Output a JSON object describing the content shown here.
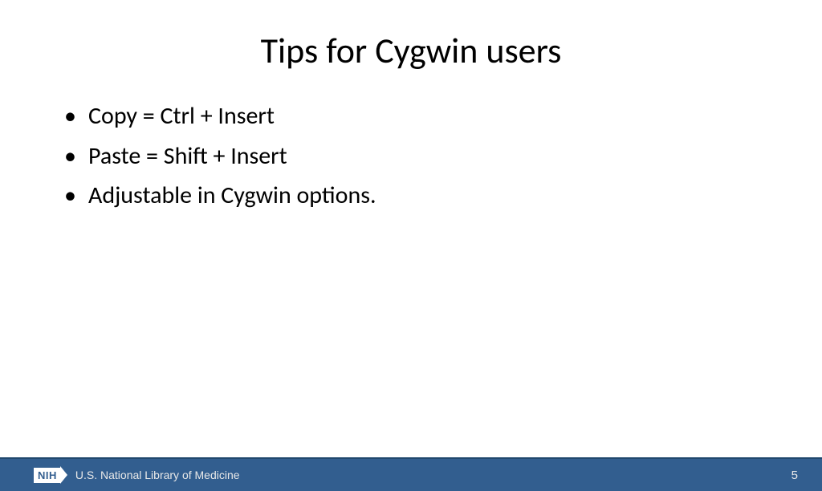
{
  "title": "Tips for Cygwin users",
  "bullets": [
    "Copy = Ctrl + Insert",
    "Paste = Shift + Insert",
    "Adjustable in Cygwin options."
  ],
  "footer": {
    "logo_text": "NIH",
    "org_name": "U.S. National Library of Medicine",
    "slide_number": "5"
  }
}
